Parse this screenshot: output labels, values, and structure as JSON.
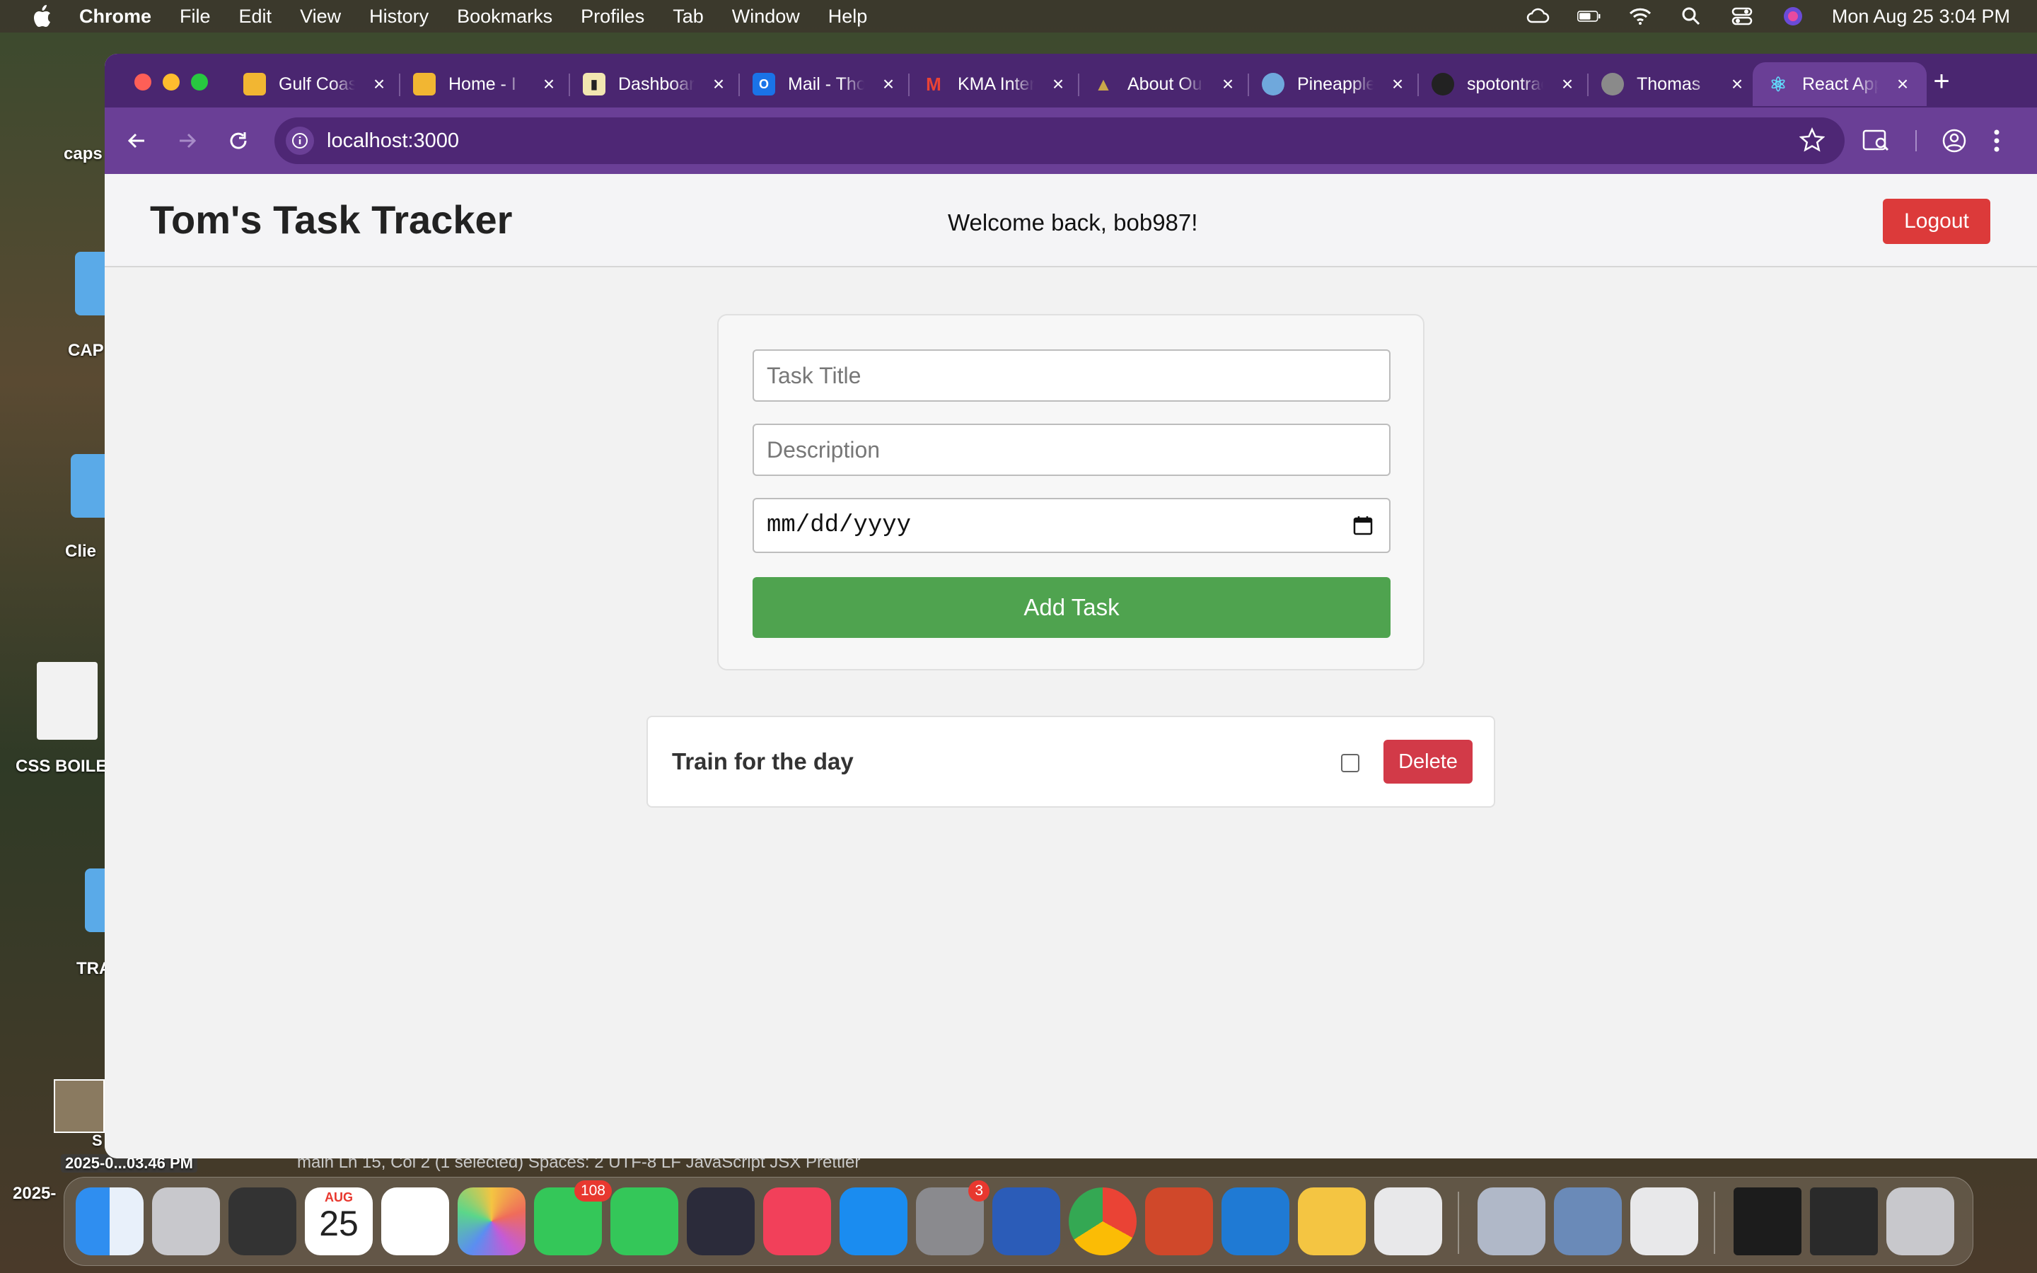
{
  "menubar": {
    "app": "Chrome",
    "items": [
      "File",
      "Edit",
      "View",
      "History",
      "Bookmarks",
      "Profiles",
      "Tab",
      "Window",
      "Help"
    ],
    "datetime": "Mon Aug 25  3:04 PM"
  },
  "desktop": {
    "labels": [
      "caps",
      "CAP",
      "Clie",
      "CSS BOILE",
      "TRA",
      "S",
      "2025-0...03.46 PM",
      "2025-"
    ]
  },
  "tabs": [
    {
      "label": "Gulf Coast",
      "icon_color": "#f2b632"
    },
    {
      "label": "Home - I",
      "icon_color": "#f2b632"
    },
    {
      "label": "Dashboard",
      "icon_color": "#f2e6b0"
    },
    {
      "label": "Mail - Thomas",
      "icon_color": "#1a73e8"
    },
    {
      "label": "KMA Internal",
      "icon_color": "#ea4335"
    },
    {
      "label": "About Our",
      "icon_color": "#c9a64a"
    },
    {
      "label": "Pineapple",
      "icon_color": "#6fa8dc"
    },
    {
      "label": "spotontrack",
      "icon_color": "#222222"
    },
    {
      "label": "Thomas",
      "icon_color": "#8a8a8a"
    },
    {
      "label": "React App",
      "icon_color": "#61dafb"
    }
  ],
  "toolbar": {
    "url": "localhost:3000"
  },
  "app": {
    "title": "Tom's Task Tracker",
    "welcome": "Welcome back, bob987!",
    "logout_label": "Logout"
  },
  "form": {
    "title_placeholder": "Task Title",
    "description_placeholder": "Description",
    "date_value": "mm/dd/yyyy",
    "add_label": "Add Task"
  },
  "tasks": [
    {
      "title": "Train for the day",
      "completed": false,
      "delete_label": "Delete"
    }
  ],
  "dock": {
    "calendar_month": "AUG",
    "calendar_day": "25",
    "messages_badge": "108",
    "settings_badge": "3"
  },
  "statusbar": {
    "text": "main   Ln 15, Col 2 (1 selected)   Spaces: 2   UTF-8   LF   JavaScript JSX   Prettier"
  },
  "colors": {
    "tab_bar": "#4a2670",
    "toolbar": "#6a3f96",
    "logout": "#dc3a3a",
    "add_button": "#4fa34f",
    "delete_button": "#d23a48"
  }
}
